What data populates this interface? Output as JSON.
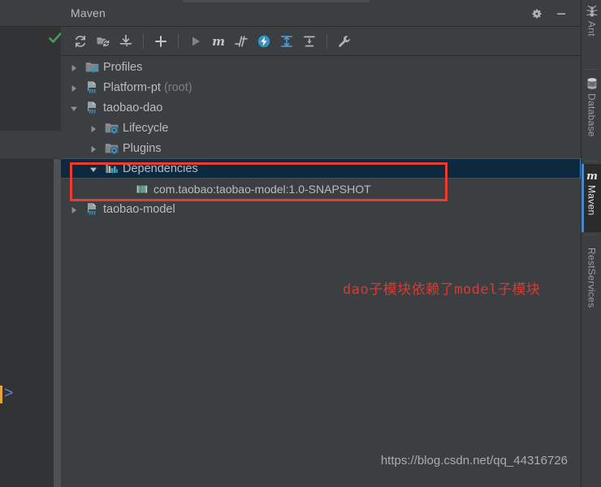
{
  "window": {
    "title": "Maven",
    "title_actions": [
      {
        "name": "gear-icon",
        "label": "Settings"
      },
      {
        "name": "minimize-icon",
        "label": "Hide"
      }
    ]
  },
  "toolbar": {
    "buttons": [
      {
        "name": "reimport-button",
        "icon": "refresh-icon",
        "label": "Reimport All Maven Projects"
      },
      {
        "name": "generate-sources-button",
        "icon": "folder-refresh-icon",
        "label": "Generate Sources and Update Folders"
      },
      {
        "name": "download-sources-button",
        "icon": "download-icon",
        "label": "Download Sources and/or Documentation"
      },
      {
        "name": "add-maven-project-button",
        "icon": "plus-icon",
        "label": "Add Maven Projects"
      },
      {
        "name": "run-button",
        "icon": "play-icon",
        "label": "Run Maven Build"
      },
      {
        "name": "execute-goal-button",
        "icon": "m-icon",
        "label": "Execute Maven Goal"
      },
      {
        "name": "toggle-skip-tests-button",
        "icon": "skip-tests-icon",
        "label": "Toggle Skip Tests Mode"
      },
      {
        "name": "toggle-offline-button",
        "icon": "offline-icon",
        "label": "Toggle Offline Mode"
      },
      {
        "name": "expand-all-button",
        "icon": "expand-all-icon",
        "label": "Expand All"
      },
      {
        "name": "collapse-all-button",
        "icon": "collapse-all-icon",
        "label": "Collapse All"
      },
      {
        "name": "maven-settings-button",
        "icon": "wrench-icon",
        "label": "Maven Settings"
      }
    ]
  },
  "tree": {
    "rows": [
      {
        "name": "tree-item-profiles",
        "label": "Profiles",
        "suffix": "",
        "indent": 0,
        "expander": "collapsed",
        "icon": "profiles-icon",
        "selected": false
      },
      {
        "name": "tree-item-platform-pt",
        "label": "Platform-pt",
        "suffix": " (root)",
        "indent": 0,
        "expander": "collapsed",
        "icon": "maven-module-icon",
        "selected": false
      },
      {
        "name": "tree-item-taobao-dao",
        "label": "taobao-dao",
        "suffix": "",
        "indent": 0,
        "expander": "expanded",
        "icon": "maven-module-icon",
        "selected": false
      },
      {
        "name": "tree-item-lifecycle",
        "label": "Lifecycle",
        "suffix": "",
        "indent": 1,
        "expander": "collapsed",
        "icon": "phase-folder-icon",
        "selected": false
      },
      {
        "name": "tree-item-plugins",
        "label": "Plugins",
        "suffix": "",
        "indent": 1,
        "expander": "collapsed",
        "icon": "phase-folder-icon",
        "selected": false
      },
      {
        "name": "tree-item-dependencies",
        "label": "Dependencies",
        "suffix": "",
        "indent": 1,
        "expander": "expanded",
        "icon": "dependencies-icon",
        "selected": true
      },
      {
        "name": "tree-item-dependency-taobao-model",
        "label": "com.taobao:taobao-model:1.0-SNAPSHOT",
        "suffix": "",
        "indent": 3,
        "expander": "none",
        "icon": "library-icon",
        "selected": false
      },
      {
        "name": "tree-item-taobao-model",
        "label": "taobao-model",
        "suffix": "",
        "indent": 0,
        "expander": "collapsed",
        "icon": "maven-module-icon",
        "selected": false
      }
    ]
  },
  "annotation": {
    "note_text": "dao子模块依赖了model子模块",
    "note_color": "#d73a33",
    "highlight_box_color": "#ee3b2f"
  },
  "watermark": {
    "text": "https://blog.csdn.net/qq_44316726"
  },
  "right_tabs": [
    {
      "name": "tab-ant",
      "label": "Ant",
      "icon": "ant-icon",
      "active": false
    },
    {
      "name": "tab-database",
      "label": "Database",
      "icon": "database-icon",
      "active": false
    },
    {
      "name": "tab-maven",
      "label": "Maven",
      "icon": "maven-m-icon",
      "active": true
    },
    {
      "name": "tab-restservices",
      "label": "RestServices",
      "icon": "restservices-icon",
      "active": false
    }
  ],
  "editor_strip": {
    "inspection_status": "ok-check",
    "gutter_marker": ">"
  },
  "colors": {
    "background": "#3c3f41",
    "panel_dark": "#313335",
    "selection": "#0d293f",
    "selection_border": "#4a80b8",
    "text": "#bbbbbb",
    "muted_text": "#808080",
    "accent_blue": "#3592c4",
    "accent_green": "#499c54",
    "annotation_red": "#ee3b2f"
  }
}
